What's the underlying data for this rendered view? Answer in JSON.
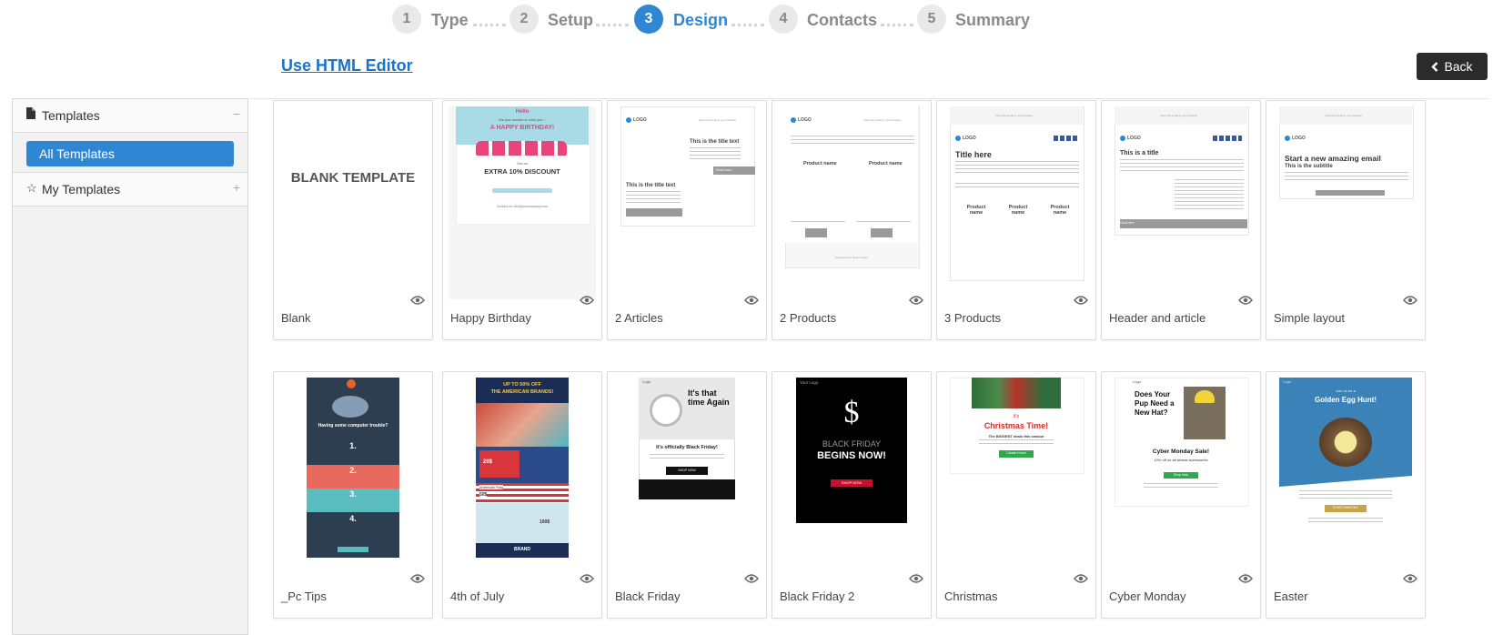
{
  "wizard": {
    "steps": [
      {
        "num": "1",
        "label": "Type"
      },
      {
        "num": "2",
        "label": "Setup"
      },
      {
        "num": "3",
        "label": "Design"
      },
      {
        "num": "4",
        "label": "Contacts"
      },
      {
        "num": "5",
        "label": "Summary"
      }
    ],
    "active_step": 3
  },
  "toolbar": {
    "html_editor_label": "Use HTML Editor",
    "back_label": "Back"
  },
  "sidebar": {
    "templates_label": "Templates",
    "templates_control": "−",
    "all_templates_label": "All Templates",
    "my_templates_label": "My Templates",
    "my_templates_control": "+"
  },
  "templates": {
    "names": [
      "Blank",
      "Happy Birthday",
      "2 Articles",
      "2 Products",
      "3 Products",
      "Header and article",
      "Simple layout",
      "_Pc Tips",
      "4th of July",
      "Black Friday",
      "Black Friday 2",
      "Christmas",
      "Cyber Monday",
      "Easter"
    ]
  },
  "thumbs": {
    "blank": {
      "text": "BLANK TEMPLATE"
    },
    "birthday": {
      "brand": "Hello",
      "line1": "We just wanted to wish you...",
      "headline": "A HAPPY BIRTHDAY!",
      "subline": "Get an",
      "offer": "EXTRA 10% DISCOUNT",
      "footer": "Contact us: info@yourcompany.com"
    },
    "logo": "LOGO",
    "webview": "View this email in your browser",
    "articles": {
      "title1": "This is the title text",
      "title2": "This is the title text",
      "read_more": "Read more..."
    },
    "products": {
      "name1": "Product name",
      "name2": "Product name",
      "buy": "Buy now",
      "footer": "Unsubscribe | Report spam"
    },
    "products3": {
      "title": "Title here",
      "name1": "Product name",
      "name2": "Product name",
      "name3": "Product name"
    },
    "header_article": {
      "title": "This is a title",
      "button": "Click here"
    },
    "simple": {
      "title": "Start a new amazing email",
      "subtitle": "This is the subtitle"
    },
    "pctips": {
      "headline": "Having some computer trouble?",
      "n1": "1.",
      "n2": "2.",
      "n3": "3.",
      "n4": "4."
    },
    "july": {
      "banner1": "UP TO 50% OFF",
      "banner2": "THE AMERICAN BRANDS!",
      "price1": "20$",
      "shop": "SHOP NOW",
      "flag": "American Flag",
      "price2": "50$",
      "price3": "100$",
      "brand": "BRAND"
    },
    "bf": {
      "logo": "Logo",
      "big": "It's that time Again",
      "headline": "It's officially Black Friday!",
      "shop": "SHOP NOW"
    },
    "bf2": {
      "logo": "Your Logo",
      "line1": "BLACK FRIDAY",
      "line2": "BEGINS NOW!",
      "shop": "SHOP NOW"
    },
    "xmas": {
      "its": "It's",
      "title": "Christmas Time!",
      "sub": "The BIGGEST deals this season",
      "btn": "Create it now!"
    },
    "cyber": {
      "logo": "Logo",
      "pup": "Does Your Pup Need a New Hat?",
      "title": "Cyber Monday Sale!",
      "sub": "10% off on all animal accessories",
      "btn": "Shop Now"
    },
    "easter": {
      "logo": "Logo",
      "small": "Join us for a",
      "title": "Golden Egg Hunt!",
      "btn": "START HUNTING"
    }
  },
  "colors": {
    "accent": "#2f86d3",
    "back_button": "#2b2b2b",
    "birthday_pink": "#e8457a",
    "christmas_red": "#d82a2a",
    "christmas_green": "#2fa84f",
    "bf_red": "#c8102e",
    "easter_blue": "#3a82b8"
  }
}
